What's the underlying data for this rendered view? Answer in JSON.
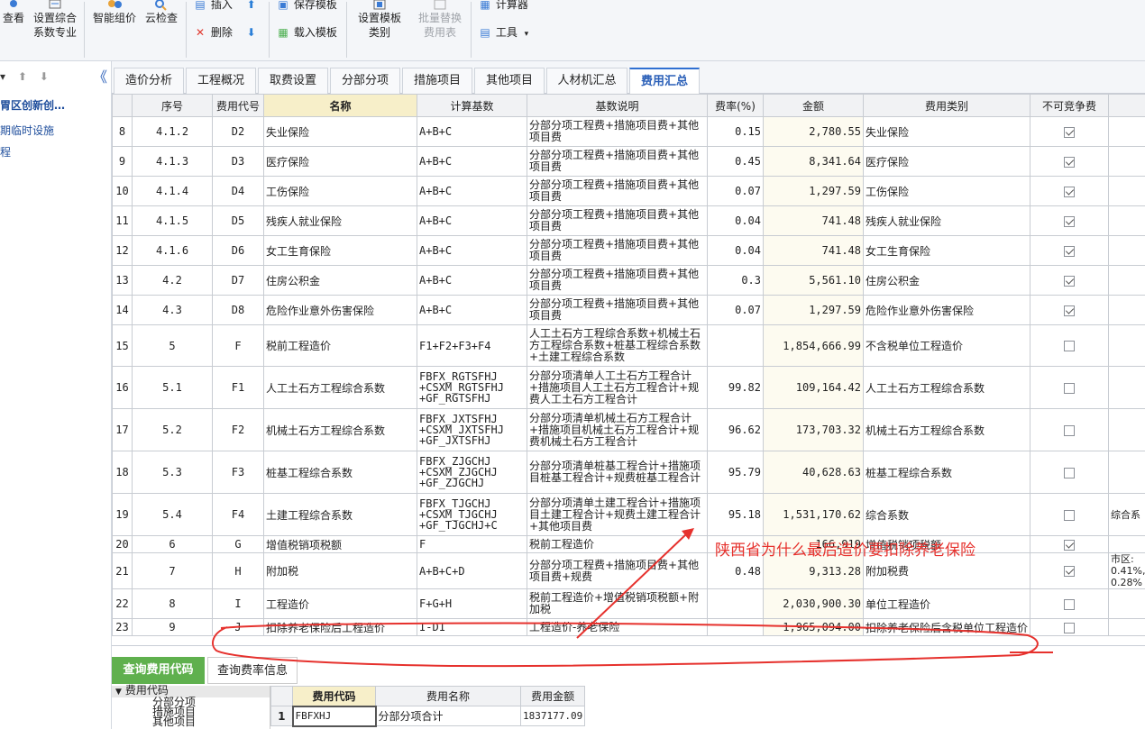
{
  "toolbar": {
    "view_label": "查看",
    "set_coef_label_1": "设置综合",
    "set_coef_label_2": "系数专业",
    "smart_price_label": "智能组价",
    "cloud_check_label": "云检查",
    "insert_label": "插入",
    "delete_label": "删除",
    "save_template_label": "保存模板",
    "load_template_label": "载入模板",
    "set_template_cat_1": "设置模板",
    "set_template_cat_2": "类别",
    "batch_replace_1": "批量替换",
    "batch_replace_2": "费用表",
    "calculator_label": "计算器",
    "tools_label": "工具"
  },
  "left_panel": {
    "collapse_glyph": "《",
    "items": [
      "胃区创新创…",
      "期临时设施",
      "程"
    ]
  },
  "tabs": [
    {
      "label": "造价分析"
    },
    {
      "label": "工程概况"
    },
    {
      "label": "取费设置"
    },
    {
      "label": "分部分项"
    },
    {
      "label": "措施项目"
    },
    {
      "label": "其他项目"
    },
    {
      "label": "人材机汇总"
    },
    {
      "label": "费用汇总"
    }
  ],
  "table": {
    "headers": [
      "",
      "序号",
      "费用代号",
      "名称",
      "计算基数",
      "基数说明",
      "费率(%)",
      "金额",
      "费用类别",
      "不可竞争费",
      ""
    ],
    "rows": [
      {
        "row": "8",
        "seq": "4.1.2",
        "code": "D2",
        "name": "失业保险",
        "base": "A+B+C",
        "desc": "分部分项工程费+措施项目费+其他项目费",
        "rate": "0.15",
        "amount": "2,780.55",
        "category": "失业保险",
        "noncomp": true,
        "extra": ""
      },
      {
        "row": "9",
        "seq": "4.1.3",
        "code": "D3",
        "name": "医疗保险",
        "base": "A+B+C",
        "desc": "分部分项工程费+措施项目费+其他项目费",
        "rate": "0.45",
        "amount": "8,341.64",
        "category": "医疗保险",
        "noncomp": true,
        "extra": ""
      },
      {
        "row": "10",
        "seq": "4.1.4",
        "code": "D4",
        "name": "工伤保险",
        "base": "A+B+C",
        "desc": "分部分项工程费+措施项目费+其他项目费",
        "rate": "0.07",
        "amount": "1,297.59",
        "category": "工伤保险",
        "noncomp": true,
        "extra": ""
      },
      {
        "row": "11",
        "seq": "4.1.5",
        "code": "D5",
        "name": "残疾人就业保险",
        "base": "A+B+C",
        "desc": "分部分项工程费+措施项目费+其他项目费",
        "rate": "0.04",
        "amount": "741.48",
        "category": "残疾人就业保险",
        "noncomp": true,
        "extra": ""
      },
      {
        "row": "12",
        "seq": "4.1.6",
        "code": "D6",
        "name": "女工生育保险",
        "base": "A+B+C",
        "desc": "分部分项工程费+措施项目费+其他项目费",
        "rate": "0.04",
        "amount": "741.48",
        "category": "女工生育保险",
        "noncomp": true,
        "extra": ""
      },
      {
        "row": "13",
        "seq": "4.2",
        "code": "D7",
        "name": "住房公积金",
        "base": "A+B+C",
        "desc": "分部分项工程费+措施项目费+其他项目费",
        "rate": "0.3",
        "amount": "5,561.10",
        "category": "住房公积金",
        "noncomp": true,
        "extra": ""
      },
      {
        "row": "14",
        "seq": "4.3",
        "code": "D8",
        "name": "危险作业意外伤害保险",
        "base": "A+B+C",
        "desc": "分部分项工程费+措施项目费+其他项目费",
        "rate": "0.07",
        "amount": "1,297.59",
        "category": "危险作业意外伤害保险",
        "noncomp": true,
        "extra": ""
      },
      {
        "row": "15",
        "seq": "5",
        "code": "F",
        "name": "税前工程造价",
        "base": "F1+F2+F3+F4",
        "desc": "人工土石方工程综合系数+机械土石方工程综合系数+桩基工程综合系数+土建工程综合系数",
        "rate": "",
        "amount": "1,854,666.99",
        "category": "不含税单位工程造价",
        "noncomp": false,
        "extra": ""
      },
      {
        "row": "16",
        "seq": "5.1",
        "code": "F1",
        "name": "人工土石方工程综合系数",
        "base": "FBFX_RGTSFHJ +CSXM_RGTSFHJ +GF_RGTSFHJ",
        "desc": "分部分项清单人工土石方工程合计+措施项目人工土石方工程合计+规费人工土石方工程合计",
        "rate": "99.82",
        "amount": "109,164.42",
        "category": "人工土石方工程综合系数",
        "noncomp": false,
        "extra": ""
      },
      {
        "row": "17",
        "seq": "5.2",
        "code": "F2",
        "name": "机械土石方工程综合系数",
        "base": "FBFX_JXTSFHJ +CSXM_JXTSFHJ +GF_JXTSFHJ",
        "desc": "分部分项清单机械土石方工程合计+措施项目机械土石方工程合计+规费机械土石方工程合计",
        "rate": "96.62",
        "amount": "173,703.32",
        "category": "机械土石方工程综合系数",
        "noncomp": false,
        "extra": ""
      },
      {
        "row": "18",
        "seq": "5.3",
        "code": "F3",
        "name": "桩基工程综合系数",
        "base": "FBFX_ZJGCHJ +CSXM_ZJGCHJ +GF_ZJGCHJ",
        "desc": "分部分项清单桩基工程合计+措施项目桩基工程合计+规费桩基工程合计",
        "rate": "95.79",
        "amount": "40,628.63",
        "category": "桩基工程综合系数",
        "noncomp": false,
        "extra": ""
      },
      {
        "row": "19",
        "seq": "5.4",
        "code": "F4",
        "name": "土建工程综合系数",
        "base": "FBFX_TJGCHJ +CSXM_TJGCHJ +GF_TJGCHJ+C",
        "desc": "分部分项清单土建工程合计+措施项目土建工程合计+规费土建工程合计+其他项目费",
        "rate": "95.18",
        "amount": "1,531,170.62",
        "category": "综合系数",
        "noncomp": false,
        "extra": "综合系"
      },
      {
        "row": "20",
        "seq": "6",
        "code": "G",
        "name": "增值税销项税额",
        "base": "F",
        "desc": "税前工程造价",
        "rate": "",
        "amount": "166,919",
        "category": "增值税销项税额",
        "noncomp": true,
        "extra": ""
      },
      {
        "row": "21",
        "seq": "7",
        "code": "H",
        "name": "附加税",
        "base": "A+B+C+D",
        "desc": "分部分项工程费+措施项目费+其他项目费+规费",
        "rate": "0.48",
        "amount": "9,313.28",
        "category": "附加税费",
        "noncomp": true,
        "extra": "市区: 0.41%, 0.28%"
      },
      {
        "row": "22",
        "seq": "8",
        "code": "I",
        "name": "工程造价",
        "base": "F+G+H",
        "desc": "税前工程造价+增值税销项税额+附加税",
        "rate": "",
        "amount": "2,030,900.30",
        "category": "单位工程造价",
        "noncomp": false,
        "extra": ""
      },
      {
        "row": "23",
        "seq": "9",
        "code": "J",
        "name": "扣除养老保险后工程造价",
        "base": "I-D1",
        "desc": "工程造价-养老保险",
        "rate": "",
        "amount": "1,965,094.00",
        "category": "扣除养老保险后含税单位工程造价",
        "noncomp": false,
        "extra": ""
      }
    ]
  },
  "bottom": {
    "tabs": [
      {
        "label": "查询费用代码"
      },
      {
        "label": "查询费率信息"
      }
    ],
    "tree": {
      "root": "费用代码",
      "children": [
        "分部分项",
        "措施项目",
        "其他项目"
      ]
    },
    "subgrid": {
      "headers": [
        "",
        "费用代码",
        "费用名称",
        "费用金额"
      ],
      "rows": [
        {
          "no": "1",
          "code": "FBFXHJ",
          "name": "分部分项合计",
          "amount": "1837177.09"
        }
      ]
    }
  },
  "annotation": {
    "text": "陕西省为什么最后造价要扣除养老保险",
    "color": "#e6312d"
  },
  "colors": {
    "active_tab": "#2f6fd1",
    "bottom_active_tab": "#5fb04e",
    "name_header": "#f7efc9",
    "amount_bg": "#fdfbf0"
  }
}
